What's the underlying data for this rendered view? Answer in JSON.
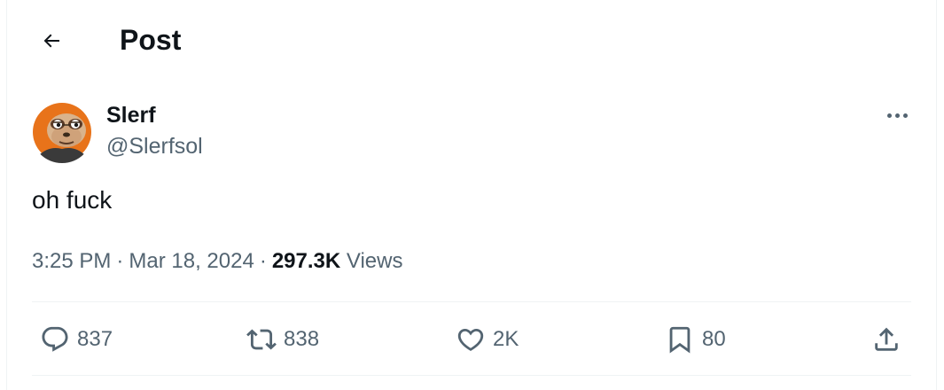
{
  "header": {
    "title": "Post",
    "back_icon": "arrow-left-icon"
  },
  "author": {
    "display_name": "Slerf",
    "handle": "@Slerfsol",
    "avatar_icon": "sloth-avatar-icon"
  },
  "post": {
    "text": "oh fuck",
    "time": "3:25 PM",
    "date": "Mar 18, 2024",
    "separator": "·",
    "views_count": "297.3K",
    "views_label": "Views"
  },
  "actions": {
    "replies": "837",
    "reposts": "838",
    "likes": "2K",
    "bookmarks": "80"
  },
  "colors": {
    "text_primary": "#0f1419",
    "text_secondary": "#536471",
    "border": "#eff3f4",
    "avatar_orange": "#e8731a"
  }
}
